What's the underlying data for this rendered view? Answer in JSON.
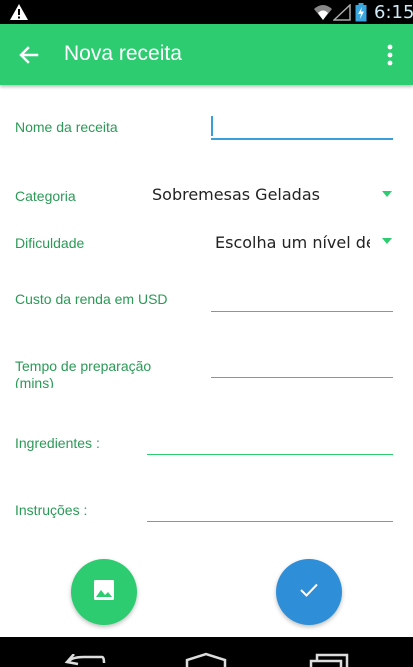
{
  "status_bar": {
    "time": "6:15",
    "icons": [
      "warning-icon",
      "wifi-icon",
      "signal-icon",
      "battery-charging-icon"
    ]
  },
  "app_bar": {
    "title": "Nova receita",
    "back_icon": "arrow-back-icon",
    "menu_icon": "more-vert-icon",
    "color": "#2ecc71"
  },
  "form": {
    "recipe_name_label": "Nome da receita",
    "recipe_name_value": "",
    "category_label": "Categoria",
    "category_value": "Sobremesas Geladas",
    "difficulty_label": "Dificuldade",
    "difficulty_value": "Escolha um nível de",
    "cost_label": "Custo da renda em USD",
    "cost_value": "",
    "prep_time_label_line1": "Tempo de preparação",
    "prep_time_label_line2": "(mins)",
    "prep_time_value": "",
    "ingredients_label": "Ingredientes :",
    "ingredients_value": "",
    "instructions_label": "Instruções :",
    "instructions_value": ""
  },
  "actions": {
    "image_button_icon": "image-icon",
    "confirm_button_icon": "check-icon",
    "image_color": "#2ecc71",
    "confirm_color": "#2f8ed8"
  },
  "nav_bar": {
    "icons": [
      "back-icon",
      "home-icon",
      "recents-icon"
    ]
  }
}
